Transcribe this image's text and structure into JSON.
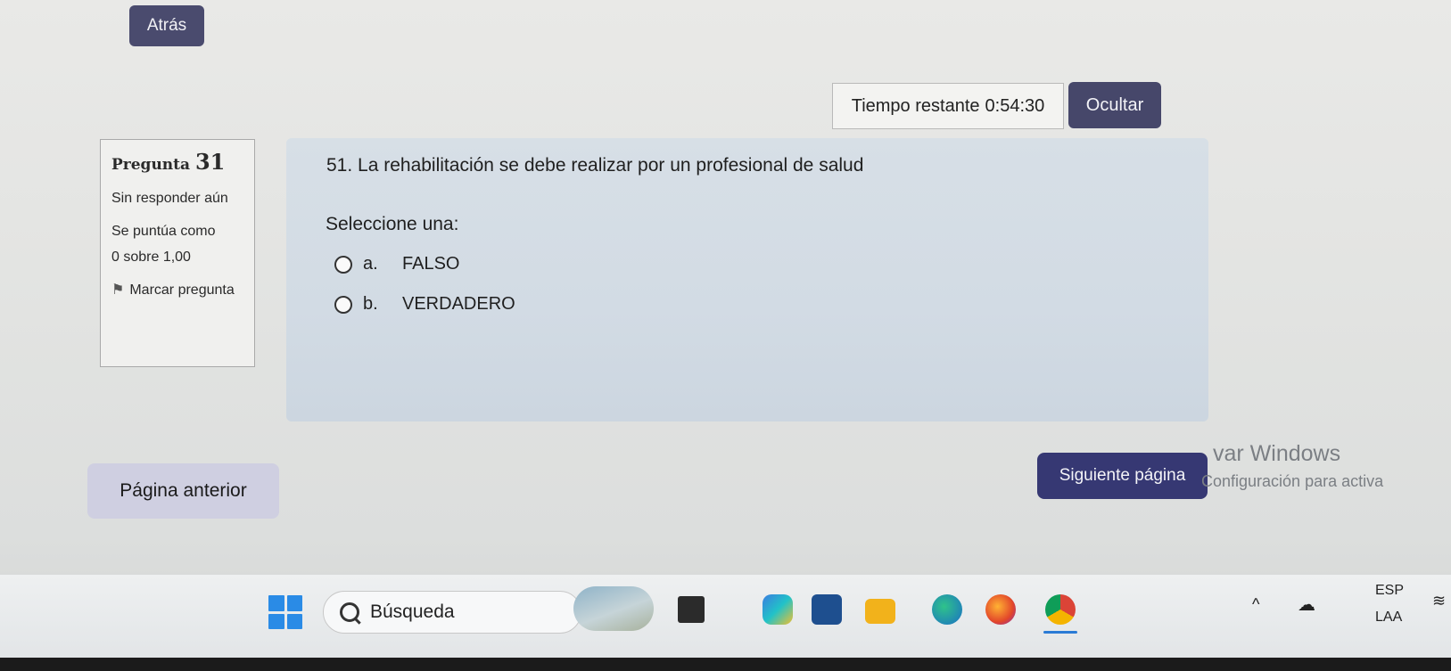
{
  "header": {
    "back_label": "Atrás"
  },
  "timer": {
    "label": "Tiempo restante",
    "value": "0:54:30",
    "hide_label": "Ocultar"
  },
  "question_info": {
    "question_word": "Pregunta",
    "question_number": "31",
    "status": "Sin responder aún",
    "score_label": "Se puntúa como",
    "score_value": "0 sobre 1,00",
    "flag_label": "Marcar pregunta"
  },
  "question": {
    "text": "51. La rehabilitación se debe realizar por un profesional de salud",
    "prompt": "Seleccione una:",
    "options": [
      {
        "letter": "a.",
        "text": "FALSO",
        "selected": false
      },
      {
        "letter": "b.",
        "text": "VERDADERO",
        "selected": false
      }
    ]
  },
  "navigation": {
    "prev_label": "Página anterior",
    "next_label": "Siguiente página"
  },
  "watermark": {
    "title": "var Windows",
    "subtitle": "Configuración para activa"
  },
  "taskbar": {
    "search_placeholder": "Búsqueda",
    "language": "ESP",
    "layout": "LAA",
    "icons": [
      "start-icon",
      "search-icon",
      "widgets-icon",
      "task-view-icon",
      "copilot-icon",
      "store-icon",
      "file-explorer-icon",
      "edge-icon",
      "firefox-icon",
      "chrome-icon"
    ]
  },
  "colors": {
    "primary_button": "#46476a",
    "next_button": "#363873",
    "question_bg": "#d7dfe6",
    "prev_button": "#cfcfe1"
  }
}
